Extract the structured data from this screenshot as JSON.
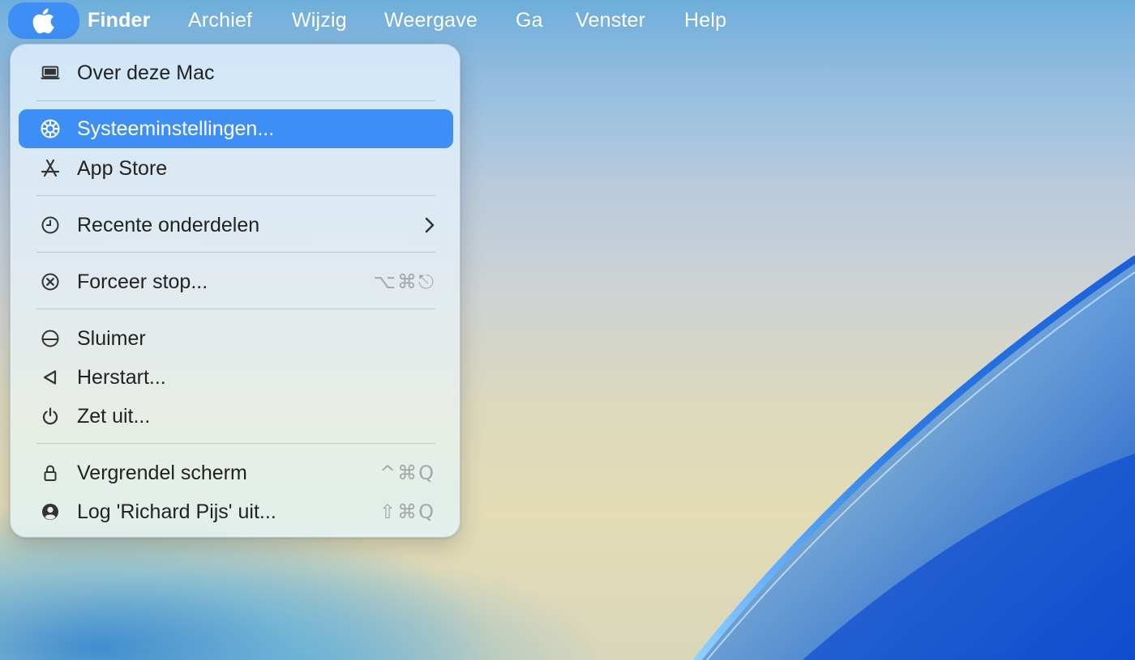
{
  "menubar": {
    "apple_icon": "apple-logo-icon",
    "items": [
      {
        "label": "Finder"
      },
      {
        "label": "Archief"
      },
      {
        "label": "Wijzig"
      },
      {
        "label": "Weergave"
      },
      {
        "label": "Ga"
      },
      {
        "label": "Venster"
      },
      {
        "label": "Help"
      }
    ]
  },
  "apple_menu": {
    "items": [
      {
        "icon": "laptop-icon",
        "label": "Over deze Mac",
        "shortcut": ""
      },
      {
        "icon": "gear-icon",
        "label": "Systeeminstellingen...",
        "shortcut": "",
        "selected": true
      },
      {
        "icon": "app-store-icon",
        "label": "App Store",
        "shortcut": ""
      },
      {
        "icon": "clock-icon",
        "label": "Recente onderdelen",
        "shortcut": "",
        "submenu": true
      },
      {
        "icon": "force-quit-icon",
        "label": "Forceer stop...",
        "shortcut": "⌥⌘⎋"
      },
      {
        "icon": "sleep-icon",
        "label": "Sluimer",
        "shortcut": ""
      },
      {
        "icon": "restart-icon",
        "label": "Herstart...",
        "shortcut": ""
      },
      {
        "icon": "power-icon",
        "label": "Zet uit...",
        "shortcut": ""
      },
      {
        "icon": "lock-icon",
        "label": "Vergrendel scherm",
        "shortcut": "^⌘Q"
      },
      {
        "icon": "user-icon",
        "label": "Log 'Richard Pijs' uit...",
        "shortcut": "⇧⌘Q"
      }
    ]
  },
  "colors": {
    "accent": "#3d8ef5",
    "menu_text": "#222222",
    "shortcut_text": "#a3a7ab"
  }
}
